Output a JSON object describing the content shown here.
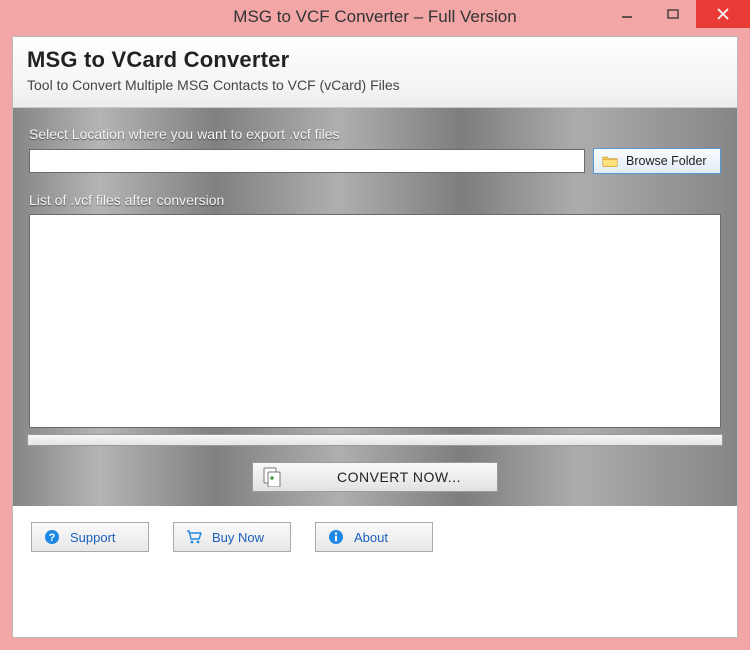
{
  "window": {
    "title": "MSG to VCF Converter – Full Version"
  },
  "header": {
    "title": "MSG to VCard Converter",
    "subtitle": "Tool to Convert Multiple MSG Contacts to VCF (vCard) Files"
  },
  "main": {
    "export_label": "Select Location where you want to export .vcf files",
    "export_path": "",
    "browse_label": "Browse Folder",
    "list_label": "List of .vcf files after conversion",
    "convert_label": "CONVERT NOW..."
  },
  "footer": {
    "support": "Support",
    "buy": "Buy Now",
    "about": "About"
  },
  "colors": {
    "title_frame": "#f2a6a6",
    "close": "#e83b35",
    "link": "#1b5fbf"
  }
}
